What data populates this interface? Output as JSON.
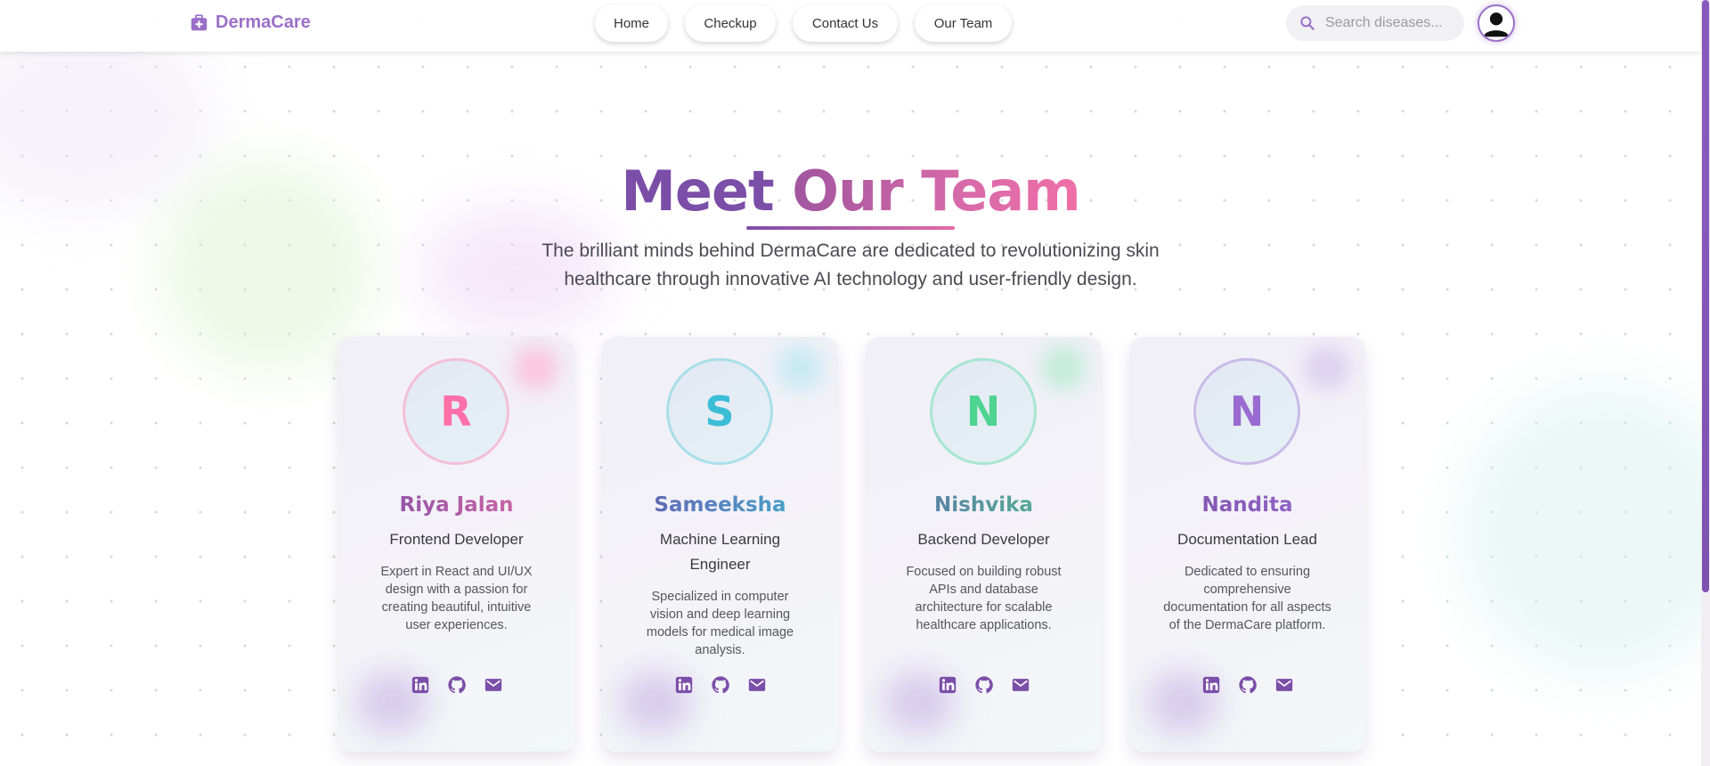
{
  "brand": {
    "name": "DermaCare",
    "logo_icon": "medical-kit-icon",
    "color": "#9b6fc8"
  },
  "nav": [
    {
      "label": "Home"
    },
    {
      "label": "Checkup"
    },
    {
      "label": "Contact Us"
    },
    {
      "label": "Our Team"
    }
  ],
  "search": {
    "placeholder": "Search diseases...",
    "icon": "search-icon"
  },
  "profile": {
    "icon": "user-avatar-icon"
  },
  "hero": {
    "title_part1": "Meet",
    "title_part2": "Our Team",
    "subtitle": "The brilliant minds behind DermaCare are dedicated to revolutionizing skin healthcare through innovative AI technology and user-friendly design."
  },
  "team": [
    {
      "initial": "R",
      "name": "Riya Jalan",
      "role": "Frontend Developer",
      "description": "Expert in React and UI/UX design with a passion for creating beautiful, intuitive user experiences.",
      "accent": "#ff6fa8"
    },
    {
      "initial": "S",
      "name": "Sameeksha",
      "role": "Machine Learning Engineer",
      "description": "Specialized in computer vision and deep learning models for medical image analysis.",
      "accent": "#3bbdd6"
    },
    {
      "initial": "N",
      "name": "Nishvika",
      "role": "Backend Developer",
      "description": "Focused on building robust APIs and database architecture for scalable healthcare applications.",
      "accent": "#4ed391"
    },
    {
      "initial": "N",
      "name": "Nandita",
      "role": "Documentation Lead",
      "description": "Dedicated to ensuring comprehensive documentation for all aspects of the DermaCare platform.",
      "accent": "#9a6bd0"
    }
  ],
  "social_icons": [
    "linkedin-icon",
    "github-icon",
    "email-icon"
  ],
  "colors": {
    "primary": "#7b4ea8",
    "pink": "#e56aa5"
  }
}
